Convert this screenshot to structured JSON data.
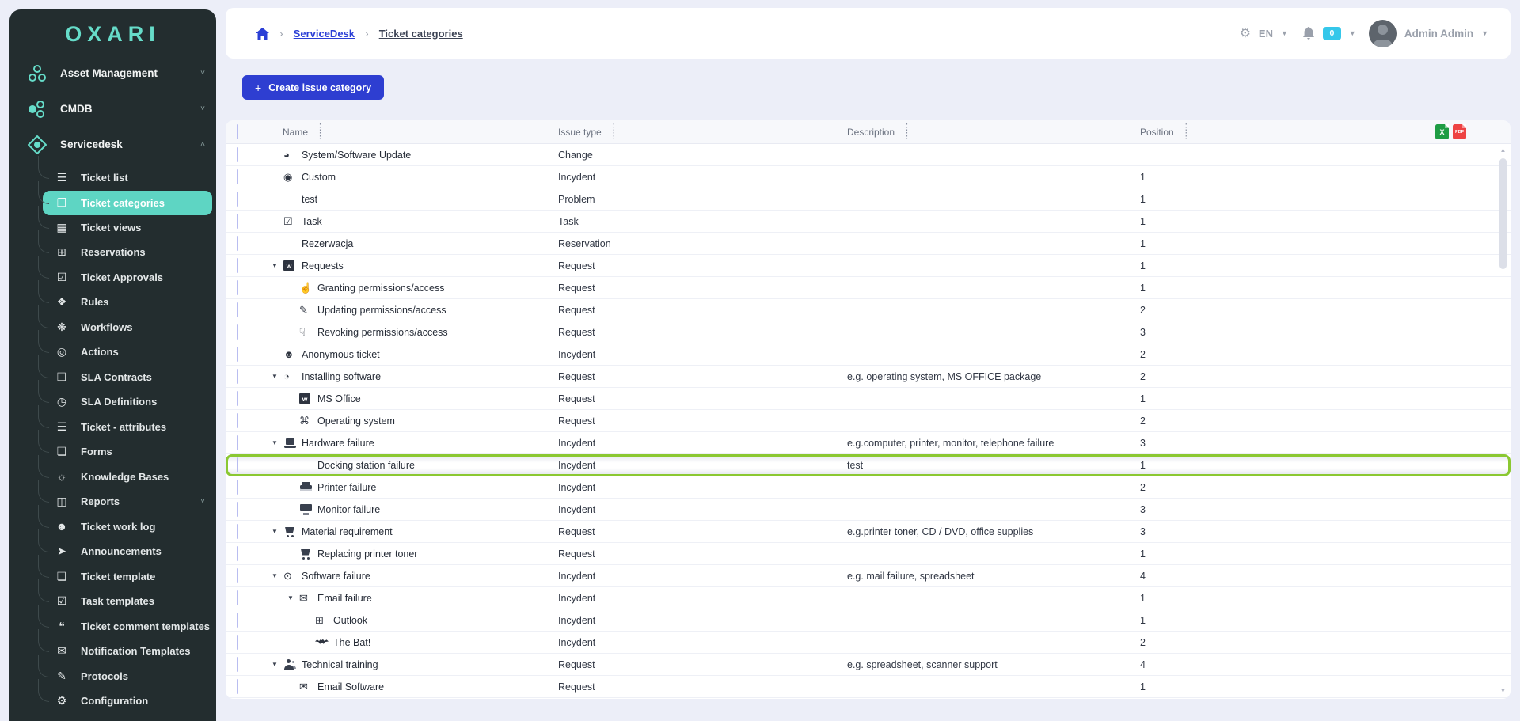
{
  "app": {
    "logo": "OXARI"
  },
  "colors": {
    "accent_teal": "#5ed5c3",
    "primary_blue": "#2e3ed1",
    "link_blue": "#2b3fd6",
    "highlight_green": "#8bc832",
    "badge_cyan": "#35c7ea",
    "sidebar_bg": "#232d2f"
  },
  "sidebar": {
    "main_items": [
      {
        "label": "Asset Management",
        "icon": "asset-management-icon",
        "caret": "down"
      },
      {
        "label": "CMDB",
        "icon": "cmdb-icon",
        "caret": "down"
      },
      {
        "label": "Servicedesk",
        "icon": "servicedesk-icon",
        "caret": "up"
      }
    ],
    "sub_items": [
      {
        "label": "Ticket list",
        "icon": "ticket-list-icon"
      },
      {
        "label": "Ticket categories",
        "icon": "ticket-categories-icon",
        "active": true
      },
      {
        "label": "Ticket views",
        "icon": "ticket-views-icon"
      },
      {
        "label": "Reservations",
        "icon": "reservations-icon"
      },
      {
        "label": "Ticket Approvals",
        "icon": "ticket-approvals-icon"
      },
      {
        "label": "Rules",
        "icon": "rules-icon"
      },
      {
        "label": "Workflows",
        "icon": "workflows-icon"
      },
      {
        "label": "Actions",
        "icon": "actions-icon"
      },
      {
        "label": "SLA Contracts",
        "icon": "sla-contracts-icon"
      },
      {
        "label": "SLA Definitions",
        "icon": "sla-definitions-icon"
      },
      {
        "label": "Ticket - attributes",
        "icon": "ticket-attributes-icon"
      },
      {
        "label": "Forms",
        "icon": "forms-icon"
      },
      {
        "label": "Knowledge Bases",
        "icon": "knowledge-bases-icon"
      },
      {
        "label": "Reports",
        "icon": "reports-icon",
        "caret": "down"
      },
      {
        "label": "Ticket work log",
        "icon": "ticket-work-log-icon"
      },
      {
        "label": "Announcements",
        "icon": "announcements-icon"
      },
      {
        "label": "Ticket template",
        "icon": "ticket-template-icon"
      },
      {
        "label": "Task templates",
        "icon": "task-templates-icon"
      },
      {
        "label": "Ticket comment templates",
        "icon": "ticket-comment-templates-icon"
      },
      {
        "label": "Notification Templates",
        "icon": "notification-templates-icon"
      },
      {
        "label": "Protocols",
        "icon": "protocols-icon"
      },
      {
        "label": "Configuration",
        "icon": "configuration-icon"
      }
    ]
  },
  "header": {
    "breadcrumb": {
      "home_icon": "home-icon",
      "level1": "ServiceDesk",
      "level2": "Ticket categories"
    },
    "language": "EN",
    "notification_count": "0",
    "user_name": "Admin Admin"
  },
  "toolbar": {
    "create_button": "Create issue category"
  },
  "table": {
    "columns": {
      "name": "Name",
      "issue_type": "Issue type",
      "description": "Description",
      "position": "Position"
    },
    "export_icons": [
      "excel-export-icon",
      "pdf-export-icon"
    ],
    "rows": [
      {
        "name": "System/Software Update",
        "level": 0,
        "caret": false,
        "icon": "pie-chart-icon",
        "type": "Change",
        "description": "",
        "position": ""
      },
      {
        "name": "Custom",
        "level": 0,
        "caret": false,
        "icon": "eye-icon",
        "type": "Incydent",
        "description": "",
        "position": "1"
      },
      {
        "name": "test",
        "level": 0,
        "caret": false,
        "icon": null,
        "type": "Problem",
        "description": "",
        "position": "1"
      },
      {
        "name": "Task",
        "level": 0,
        "caret": false,
        "icon": "checklist-icon",
        "type": "Task",
        "description": "",
        "position": "1"
      },
      {
        "name": "Rezerwacja",
        "level": 0,
        "caret": false,
        "icon": null,
        "type": "Reservation",
        "description": "",
        "position": "1"
      },
      {
        "name": "Requests",
        "level": 0,
        "caret": true,
        "icon": "word-doc-icon",
        "type": "Request",
        "description": "",
        "position": "1"
      },
      {
        "name": "Granting permissions/access",
        "level": 1,
        "caret": false,
        "icon": "thumbs-up-icon",
        "type": "Request",
        "description": "",
        "position": "1"
      },
      {
        "name": "Updating permissions/access",
        "level": 1,
        "caret": false,
        "icon": "edit-note-icon",
        "type": "Request",
        "description": "",
        "position": "2"
      },
      {
        "name": "Revoking permissions/access",
        "level": 1,
        "caret": false,
        "icon": "thumbs-down-icon",
        "type": "Request",
        "description": "",
        "position": "3"
      },
      {
        "name": "Anonymous ticket",
        "level": 0,
        "caret": false,
        "icon": "anonymous-icon",
        "type": "Incydent",
        "description": "",
        "position": "2"
      },
      {
        "name": "Installing software",
        "level": 0,
        "caret": true,
        "icon": "drive-icon",
        "type": "Request",
        "description": "e.g. operating system, MS OFFICE package",
        "position": "2"
      },
      {
        "name": "MS Office",
        "level": 1,
        "caret": false,
        "icon": "word-doc-icon",
        "type": "Request",
        "description": "",
        "position": "1"
      },
      {
        "name": "Operating system",
        "level": 1,
        "caret": false,
        "icon": "apple-icon",
        "type": "Request",
        "description": "",
        "position": "2"
      },
      {
        "name": "Hardware failure",
        "level": 0,
        "caret": true,
        "icon": "laptop-icon",
        "type": "Incydent",
        "description": "e.g.computer, printer, monitor, telephone failure",
        "position": "3"
      },
      {
        "name": "Docking station failure",
        "level": 1,
        "caret": false,
        "icon": null,
        "type": "Incydent",
        "description": "test",
        "position": "1",
        "highlighted": true
      },
      {
        "name": "Printer failure",
        "level": 1,
        "caret": false,
        "icon": "printer-icon",
        "type": "Incydent",
        "description": "",
        "position": "2"
      },
      {
        "name": "Monitor failure",
        "level": 1,
        "caret": false,
        "icon": "monitor-icon",
        "type": "Incydent",
        "description": "",
        "position": "3"
      },
      {
        "name": "Material requirement",
        "level": 0,
        "caret": true,
        "icon": "cart-icon",
        "type": "Request",
        "description": "e.g.printer toner, CD / DVD, office supplies",
        "position": "3"
      },
      {
        "name": "Replacing printer toner",
        "level": 1,
        "caret": false,
        "icon": "cart-icon",
        "type": "Request",
        "description": "",
        "position": "1"
      },
      {
        "name": "Software failure",
        "level": 0,
        "caret": true,
        "icon": "cd-icon",
        "type": "Incydent",
        "description": "e.g. mail failure, spreadsheet",
        "position": "4"
      },
      {
        "name": "Email failure",
        "level": 1,
        "caret": true,
        "icon": "envelope-icon",
        "type": "Incydent",
        "description": "",
        "position": "1"
      },
      {
        "name": "Outlook",
        "level": 2,
        "caret": false,
        "icon": "windows-icon",
        "type": "Incydent",
        "description": "",
        "position": "1"
      },
      {
        "name": "The Bat!",
        "level": 2,
        "caret": false,
        "icon": "bat-icon",
        "type": "Incydent",
        "description": "",
        "position": "2"
      },
      {
        "name": "Technical training",
        "level": 0,
        "caret": true,
        "icon": "people-icon",
        "type": "Request",
        "description": "e.g. spreadsheet, scanner support",
        "position": "4"
      },
      {
        "name": "Email Software",
        "level": 1,
        "caret": false,
        "icon": "email-software-icon",
        "type": "Request",
        "description": "",
        "position": "1"
      }
    ]
  }
}
